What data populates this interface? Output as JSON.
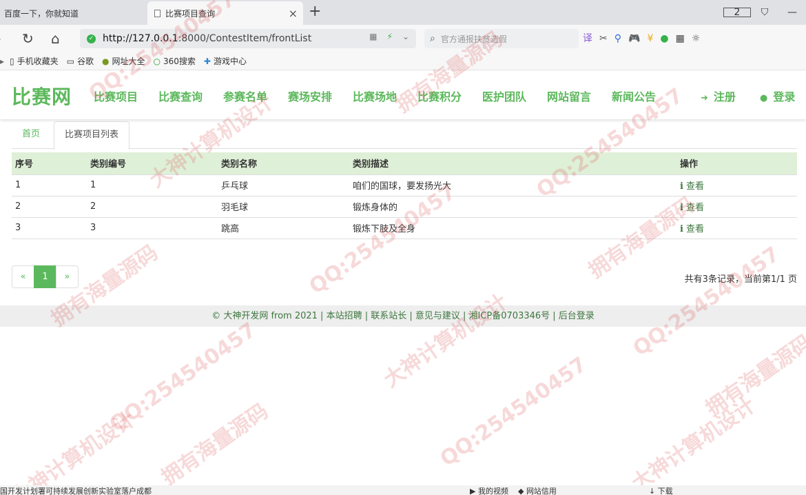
{
  "browser": {
    "tabs": [
      {
        "title": "百度一下，你就知道",
        "active": false
      },
      {
        "title": "比赛项目查询",
        "active": true
      }
    ],
    "tab_count": "2",
    "url_prefix": "http://127.0.0.1",
    "url_rest": ":8000/ContestItem/frontList",
    "search_placeholder": "官方通报扶贫造假",
    "bookmarks": [
      {
        "icon": "phone-icon",
        "label": "手机收藏夹"
      },
      {
        "icon": "page-icon",
        "label": "谷歌"
      },
      {
        "icon": "globe-icon",
        "label": "网址大全"
      },
      {
        "icon": "search-360-icon",
        "label": "360搜索"
      },
      {
        "icon": "game-icon",
        "label": "游戏中心"
      }
    ],
    "status_left": "国开发计划署可持续发展创新实验室落户成都",
    "status_right": [
      "我的视频",
      "网站信用",
      "下载"
    ]
  },
  "site": {
    "brand": "比赛网",
    "nav": [
      "比赛项目",
      "比赛查询",
      "参赛名单",
      "赛场安排",
      "比赛场地",
      "比赛积分",
      "医护团队",
      "网站留言",
      "新闻公告"
    ],
    "register": "注册",
    "login": "登录"
  },
  "breadcrumb": {
    "home": "首页",
    "current": "比赛项目列表"
  },
  "table": {
    "headers": [
      "序号",
      "类别编号",
      "类别名称",
      "类别描述",
      "操作"
    ],
    "rows": [
      {
        "no": "1",
        "code": "1",
        "name": "乒乓球",
        "desc": "咱们的国球，要发扬光大",
        "action": "查看"
      },
      {
        "no": "2",
        "code": "2",
        "name": "羽毛球",
        "desc": "锻炼身体的",
        "action": "查看"
      },
      {
        "no": "3",
        "code": "3",
        "name": "跳高",
        "desc": "锻炼下肢及全身",
        "action": "查看"
      }
    ]
  },
  "pagination": {
    "prev": "«",
    "current": "1",
    "next": "»",
    "info": "共有3条记录，当前第1/1 页"
  },
  "footer": {
    "text": "© 大神开发网 from 2021 | 本站招聘 | 联系站长 | 意见与建议 | 湘ICP备0703346号 | 后台登录"
  },
  "watermark": [
    "QQ:254540457",
    "拥有海量源码",
    "大神计算机设计"
  ],
  "colors": {
    "accent": "#5cb85c",
    "table_header_bg": "#dff0d8",
    "link_dark_green": "#3c763d",
    "footer_bg": "#eeeeee"
  }
}
